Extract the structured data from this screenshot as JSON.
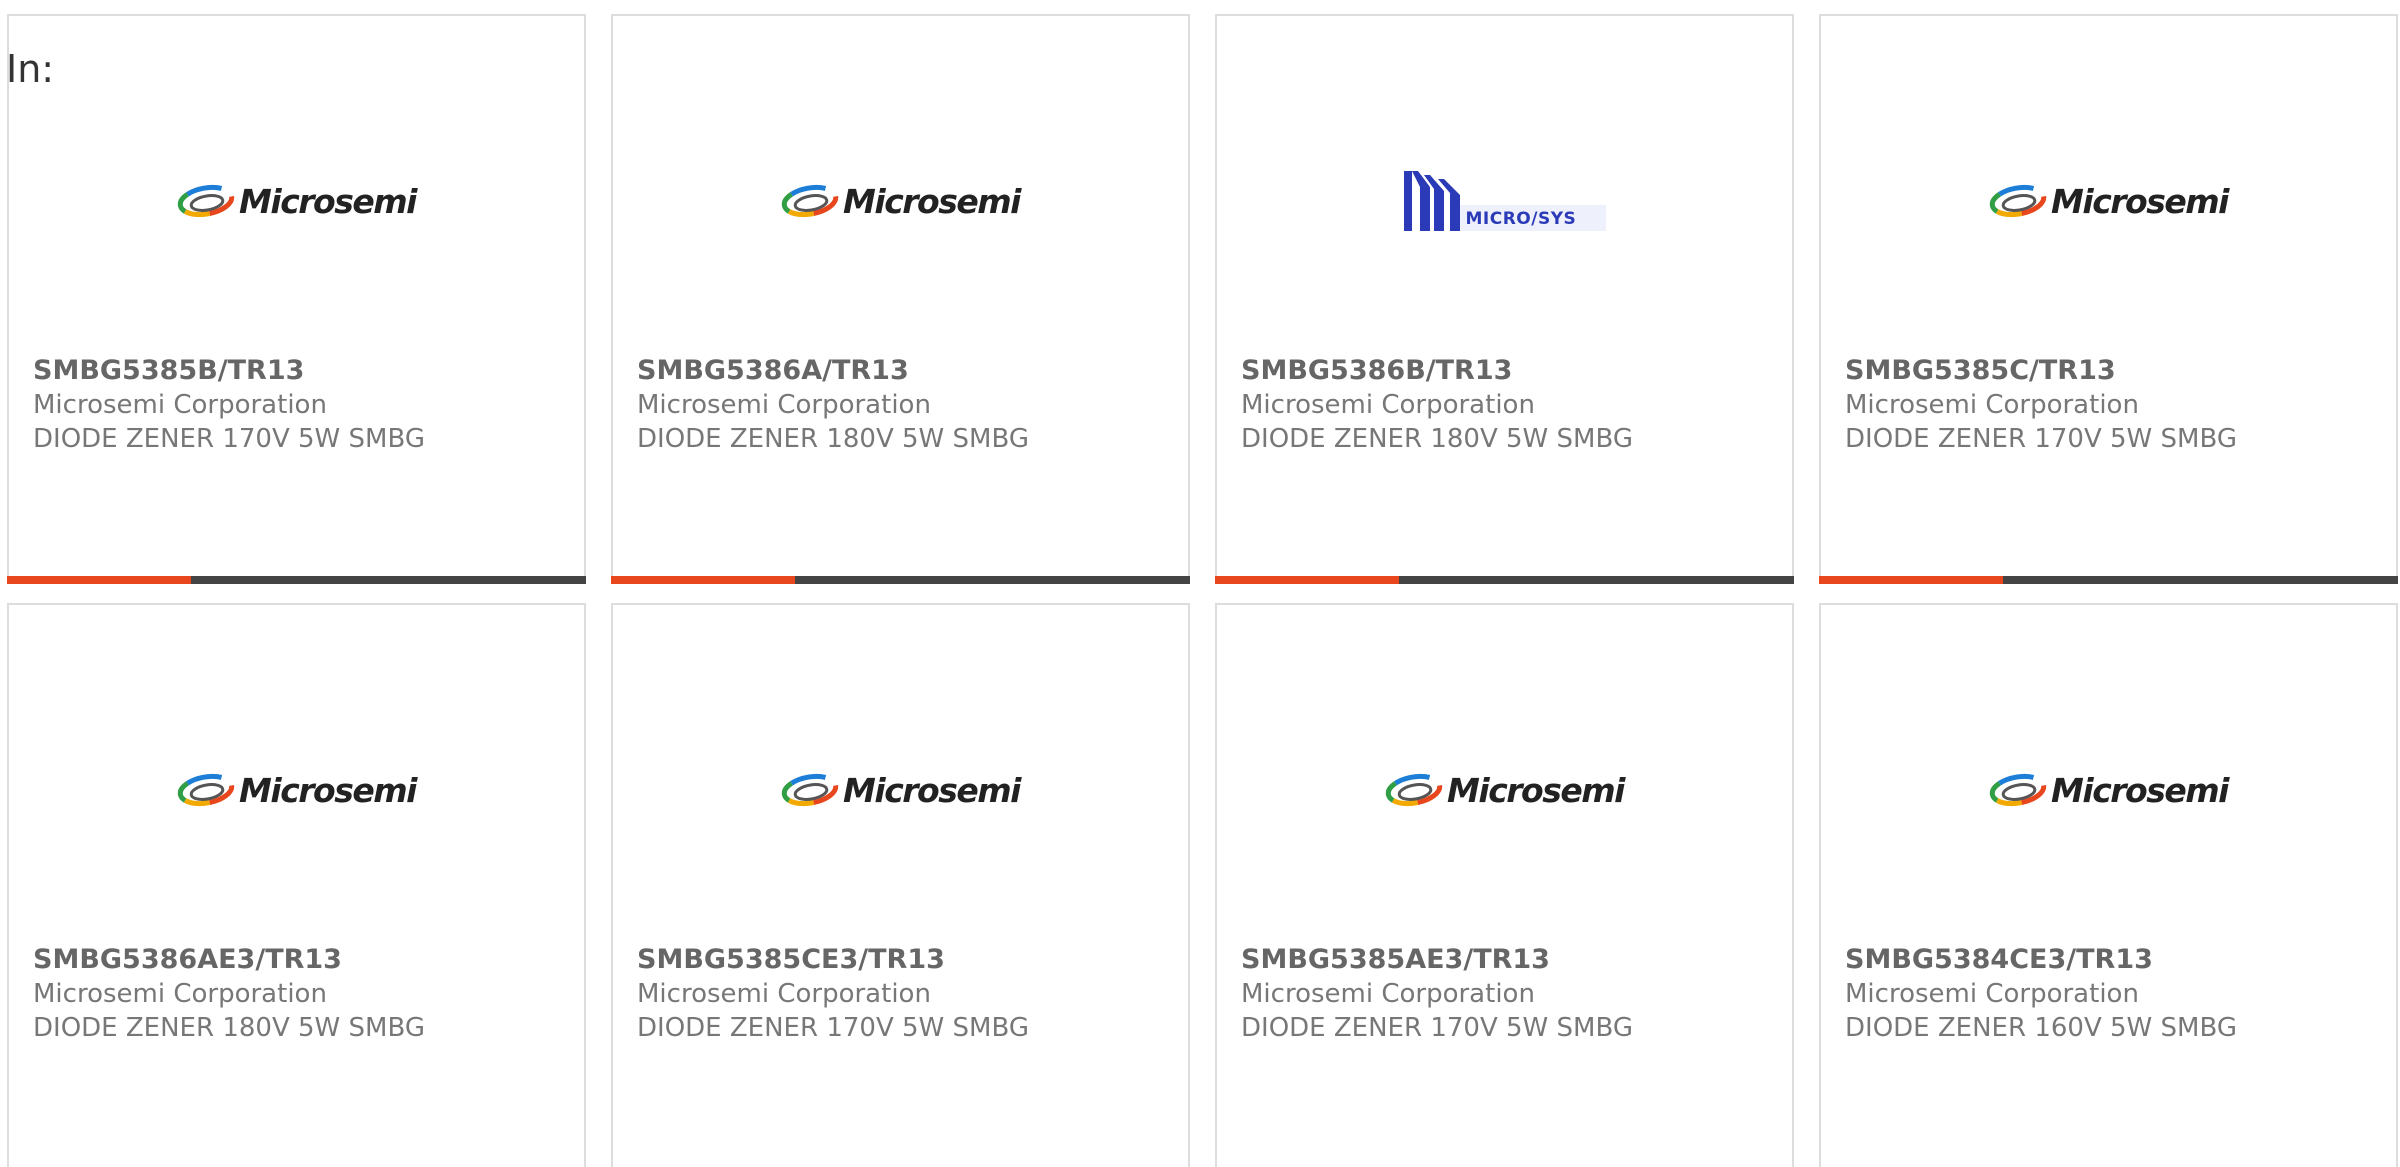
{
  "header": {
    "in_label": "In:"
  },
  "colors": {
    "accent_bar": "#e8461c",
    "bar_rest": "#444444",
    "card_border": "#dddddd",
    "microsys_blue": "#2b3bb8"
  },
  "products": [
    {
      "part": "SMBG5385B/TR13",
      "manufacturer": "Microsemi Corporation",
      "description": "DIODE ZENER 170V 5W SMBG",
      "logo": "Microsemi",
      "logo_icon": "microsemi-logo"
    },
    {
      "part": "SMBG5386A/TR13",
      "manufacturer": "Microsemi Corporation",
      "description": "DIODE ZENER 180V 5W SMBG",
      "logo": "Microsemi",
      "logo_icon": "microsemi-logo"
    },
    {
      "part": "SMBG5386B/TR13",
      "manufacturer": "Microsemi Corporation",
      "description": "DIODE ZENER 180V 5W SMBG",
      "logo": "MICRO/SYS",
      "logo_icon": "microsys-logo"
    },
    {
      "part": "SMBG5385C/TR13",
      "manufacturer": "Microsemi Corporation",
      "description": "DIODE ZENER 170V 5W SMBG",
      "logo": "Microsemi",
      "logo_icon": "microsemi-logo"
    },
    {
      "part": "SMBG5386AE3/TR13",
      "manufacturer": "Microsemi Corporation",
      "description": "DIODE ZENER 180V 5W SMBG",
      "logo": "Microsemi",
      "logo_icon": "microsemi-logo"
    },
    {
      "part": "SMBG5385CE3/TR13",
      "manufacturer": "Microsemi Corporation",
      "description": "DIODE ZENER 170V 5W SMBG",
      "logo": "Microsemi",
      "logo_icon": "microsemi-logo"
    },
    {
      "part": "SMBG5385AE3/TR13",
      "manufacturer": "Microsemi Corporation",
      "description": "DIODE ZENER 170V 5W SMBG",
      "logo": "Microsemi",
      "logo_icon": "microsemi-logo"
    },
    {
      "part": "SMBG5384CE3/TR13",
      "manufacturer": "Microsemi Corporation",
      "description": "DIODE ZENER 160V 5W SMBG",
      "logo": "Microsemi",
      "logo_icon": "microsemi-logo"
    }
  ]
}
